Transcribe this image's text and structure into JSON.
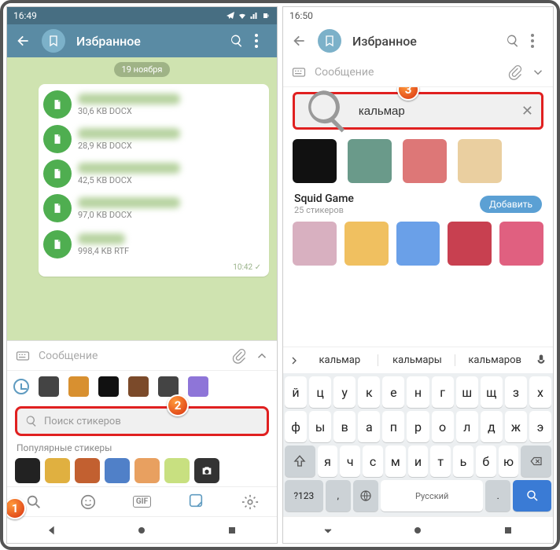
{
  "left": {
    "status": {
      "time": "16:49"
    },
    "toolbar": {
      "title": "Избранное"
    },
    "date_pill": "19 ноября",
    "files": [
      {
        "size": "30,6 KB DOCX"
      },
      {
        "size": "28,9 KB DOCX"
      },
      {
        "size": "42,5 KB DOCX"
      },
      {
        "size": "97,0 KB DOCX"
      },
      {
        "size": "998,4 KB RTF"
      }
    ],
    "msg_time": "10:42 ✓",
    "input_placeholder": "Сообщение",
    "search_placeholder": "Поиск стикеров",
    "popular_label": "Популярные стикеры",
    "callouts": {
      "one": "1",
      "two": "2"
    }
  },
  "right": {
    "status": {
      "time": "16:50"
    },
    "toolbar": {
      "title": "Избранное"
    },
    "input_placeholder": "Сообщение",
    "search_value": "кальмар",
    "pack": {
      "name": "Squid Game",
      "count": "25 стикеров",
      "add": "Добавить"
    },
    "suggestions": [
      "кальмар",
      "кальмары",
      "кальмаров"
    ],
    "callouts": {
      "three": "3"
    },
    "kbd": {
      "r1": [
        "й",
        "ц",
        "у",
        "к",
        "е",
        "н",
        "г",
        "ш",
        "щ",
        "з",
        "х"
      ],
      "r2": [
        "ф",
        "ы",
        "в",
        "а",
        "п",
        "р",
        "о",
        "л",
        "д",
        "ж",
        "э"
      ],
      "r3": [
        "я",
        "ч",
        "с",
        "м",
        "и",
        "т",
        "ь",
        "б",
        "ю"
      ],
      "r4": {
        "numkey": "?123",
        "lang": "Русский"
      }
    }
  }
}
